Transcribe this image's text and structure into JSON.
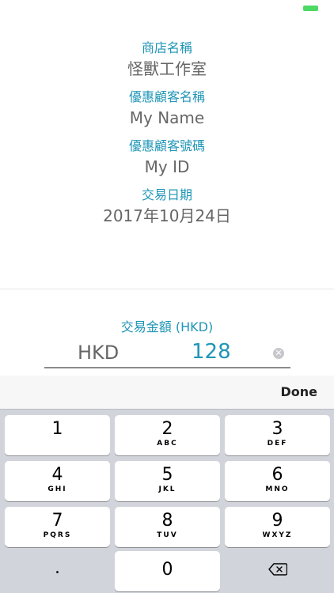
{
  "store": {
    "label": "商店名稱",
    "value": "怪獸工作室"
  },
  "member_name": {
    "label": "優惠顧客名稱",
    "value": "My Name"
  },
  "member_id": {
    "label": "優惠顧客號碼",
    "value": "My ID"
  },
  "date": {
    "label": "交易日期",
    "value": "2017年10月24日"
  },
  "amount": {
    "label": "交易金額 (HKD)",
    "currency": "HKD",
    "value": "128"
  },
  "keyboard": {
    "done": "Done",
    "keys": [
      {
        "digit": "1",
        "letters": ""
      },
      {
        "digit": "2",
        "letters": "ABC"
      },
      {
        "digit": "3",
        "letters": "DEF"
      },
      {
        "digit": "4",
        "letters": "GHI"
      },
      {
        "digit": "5",
        "letters": "JKL"
      },
      {
        "digit": "6",
        "letters": "MNO"
      },
      {
        "digit": "7",
        "letters": "PQRS"
      },
      {
        "digit": "8",
        "letters": "TUV"
      },
      {
        "digit": "9",
        "letters": "WXYZ"
      }
    ],
    "dot": ".",
    "zero": "0"
  },
  "icons": {
    "battery": "battery-icon",
    "clear": "clear-icon",
    "backspace": "backspace-icon"
  }
}
